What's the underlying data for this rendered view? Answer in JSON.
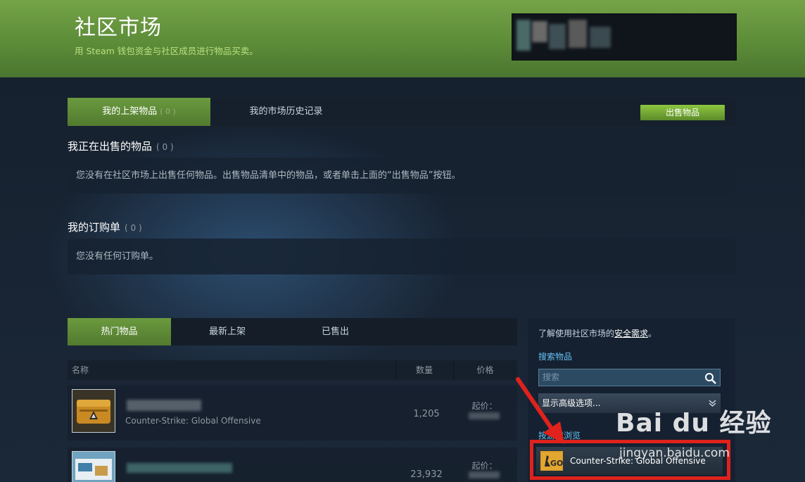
{
  "header": {
    "title": "社区市场",
    "subtitle": "用 Steam 钱包资金与社区成员进行物品买卖。"
  },
  "top_tabs": [
    {
      "label": "我的上架物品",
      "count": "( 0 )"
    },
    {
      "label": "我的市场历史记录"
    }
  ],
  "sell_button": "出售物品",
  "selling": {
    "title": "我正在出售的物品",
    "count": "( 0 )",
    "empty_text": "您没有在社区市场上出售任何物品。出售物品清单中的物品，或者单击上面的“出售物品”按钮。"
  },
  "buy_orders": {
    "title": "我的订购单",
    "count": "( 0 )",
    "empty_text": "您没有任何订购单。"
  },
  "bottom_tabs": [
    "热门物品",
    "最新上架",
    "已售出"
  ],
  "table": {
    "columns": [
      "名称",
      "数量",
      "价格"
    ],
    "rows": [
      {
        "game": "Counter-Strike: Global Offensive",
        "quantity": "1,205",
        "price_label": "起价："
      },
      {
        "game": "",
        "quantity": "23,932",
        "price_label": "起价："
      }
    ]
  },
  "sidebar": {
    "safety_prefix": "了解使用社区市场的",
    "safety_link": "安全需求",
    "safety_suffix": "。",
    "search_heading": "搜索物品",
    "search_placeholder": "搜索",
    "advanced_label": "显示高级选项...",
    "browse_heading": "按游戏浏览",
    "game_name": "Counter-Strike: Global Offensive"
  },
  "watermark": {
    "brand": "Bai du 经验",
    "url": "jingyan.baidu.com"
  },
  "colors": {
    "accent_green": "#5c8b2a",
    "highlight_red": "#e0221c",
    "background": "#1b2838"
  }
}
